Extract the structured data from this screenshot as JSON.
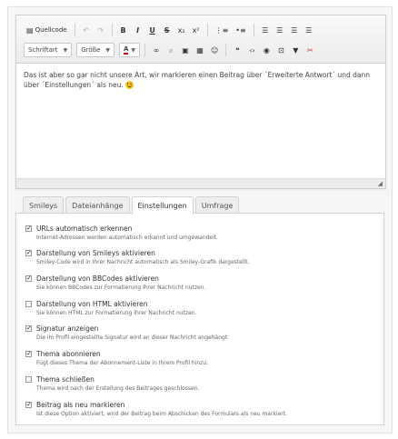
{
  "toolbar": {
    "source_label": "Quellcode",
    "font_combo": "Schriftart",
    "size_combo": "Größe",
    "color_label": "A"
  },
  "editor": {
    "content": "Das ist aber so gar nicht unsere Art, wir markieren einen Beitrag über ´Erweiterte Antwort´ und dann über ´Einstellungen´ als neu."
  },
  "tabs": [
    {
      "label": "Smileys"
    },
    {
      "label": "Dateianhänge"
    },
    {
      "label": "Einstellungen"
    },
    {
      "label": "Umfrage"
    }
  ],
  "options": [
    {
      "label": "URLs automatisch erkennen",
      "desc": "Internet-Adressen werden automatisch erkannt und umgewandelt.",
      "checked": true
    },
    {
      "label": "Darstellung von Smileys aktivieren",
      "desc": "Smiley-Code wird in Ihrer Nachricht automatisch als Smiley-Grafik dargestellt.",
      "checked": true
    },
    {
      "label": "Darstellung von BBCodes aktivieren",
      "desc": "Sie können BBCodes zur Formatierung Ihrer Nachricht nutzen.",
      "checked": true
    },
    {
      "label": "Darstellung von HTML aktivieren",
      "desc": "Sie können HTML zur Formatierung Ihrer Nachricht nutzen.",
      "checked": false
    },
    {
      "label": "Signatur anzeigen",
      "desc": "Die im Profil eingestellte Signatur wird an dieser Nachricht angehängt.",
      "checked": true
    },
    {
      "label": "Thema abonnieren",
      "desc": "Fügt dieses Thema der Abonnement-Liste in Ihrem Profil hinzu.",
      "checked": true
    },
    {
      "label": "Thema schließen",
      "desc": "Thema wird nach der Erstellung des Beitrages geschlossen.",
      "checked": false
    },
    {
      "label": "Beitrag als neu markieren",
      "desc": "Ist diese Option aktiviert, wird der Beitrag beim Abschicken des Formulars als neu markiert.",
      "checked": true
    }
  ]
}
